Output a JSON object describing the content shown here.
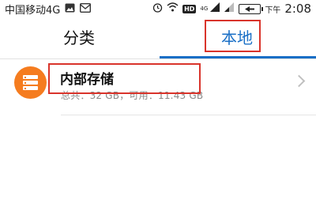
{
  "status_bar": {
    "carrier": "中国移动4G",
    "hd": "HD",
    "net": "4G",
    "battery": "",
    "ampm": "下午",
    "time": "2:08"
  },
  "tabs": [
    {
      "label": "分类",
      "active": false
    },
    {
      "label": "本地",
      "active": true
    }
  ],
  "storage": {
    "title": "内部存储",
    "detail": "总共：32 GB，可用：11.43 GB"
  },
  "colors": {
    "accent": "#1a6fc6",
    "highlight": "#d9342b",
    "storage_icon": "#f57c1f"
  }
}
